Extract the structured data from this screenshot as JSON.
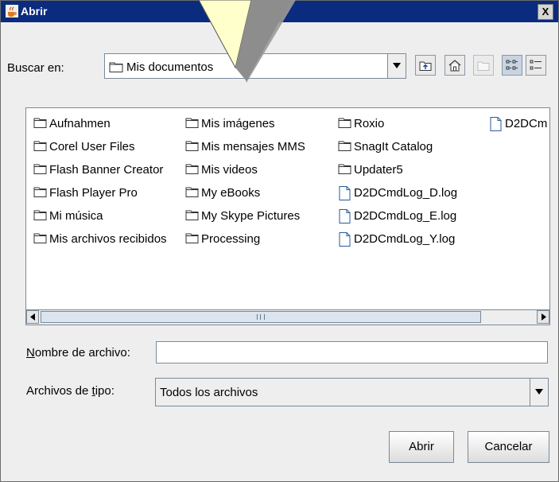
{
  "window": {
    "title": "Abrir",
    "close_glyph": "X"
  },
  "look_in": {
    "label": "Buscar en:",
    "value": "Mis documentos"
  },
  "toolbar": [
    "up-one-level-icon",
    "home-icon",
    "new-folder-icon",
    "list-view-icon",
    "details-view-icon"
  ],
  "files": {
    "col1": [
      "Aufnahmen",
      "Corel User Files",
      "Flash Banner Creator",
      "Flash Player Pro",
      "Mi música",
      "Mis archivos recibidos"
    ],
    "col2": [
      "Mis imágenes",
      "Mis mensajes MMS",
      "Mis videos",
      "My eBooks",
      "My Skype Pictures",
      "Processing"
    ],
    "col3": [
      "Roxio",
      "SnagIt Catalog",
      "Updater5",
      "D2DCmdLog_D.log",
      "D2DCmdLog_E.log",
      "D2DCmdLog_Y.log"
    ],
    "col4": [
      "D2DCm"
    ]
  },
  "filename": {
    "label": "Nombre de archivo:",
    "value": ""
  },
  "filetype": {
    "label": "Archivos de tipo:",
    "value": "Todos los archivos"
  },
  "buttons": {
    "open": "Abrir",
    "cancel": "Cancelar"
  }
}
